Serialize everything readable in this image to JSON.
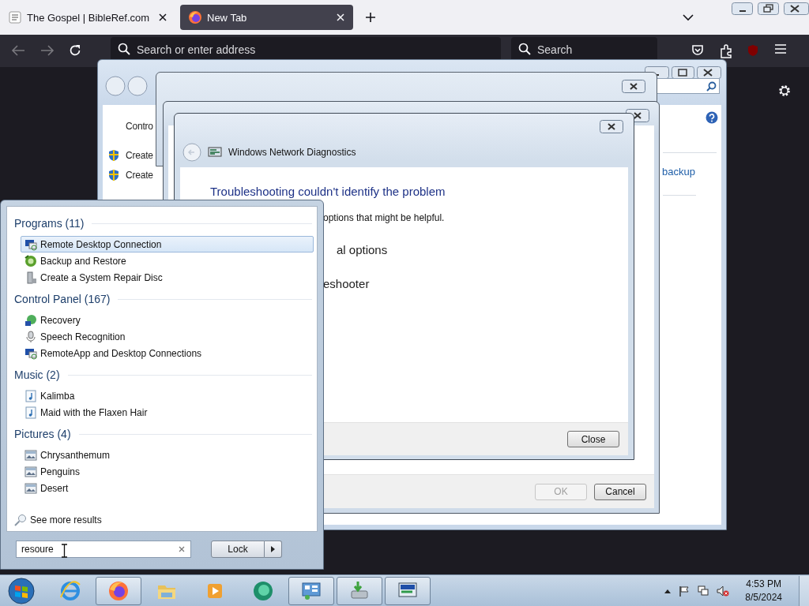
{
  "browser": {
    "tabs": [
      {
        "kind": "book",
        "title": "The Gospel | BibleRef.com",
        "selected": false
      },
      {
        "kind": "firefox",
        "title": "New Tab",
        "selected": true
      }
    ],
    "address_placeholder": "Search or enter address",
    "search_placeholder": "Search"
  },
  "control_panel": {
    "breadcrumb": "Contro",
    "tasks": [
      "Create",
      "Create"
    ],
    "link": "backup"
  },
  "troubleshooter_dialog": {
    "buttons": [
      {
        "label": "OK",
        "disabled": true
      },
      {
        "label": "Cancel",
        "disabled": false
      }
    ]
  },
  "diagnostics_dialog": {
    "title": "Windows Network Diagnostics",
    "heading": "Troubleshooting couldn't identify the problem",
    "text": "options that might be helpful.",
    "options": [
      "al options",
      "eshooter"
    ],
    "button": "Close"
  },
  "start_menu": {
    "groups": [
      {
        "title": "Programs (11)",
        "items": [
          {
            "kind": "remote",
            "label": "Remote Desktop Connection",
            "selected": true
          },
          {
            "kind": "backup",
            "label": "Backup and Restore",
            "selected": false
          },
          {
            "kind": "disc",
            "label": "Create a System Repair Disc",
            "selected": false
          }
        ]
      },
      {
        "title": "Control Panel (167)",
        "items": [
          {
            "kind": "recovery",
            "label": "Recovery",
            "selected": false
          },
          {
            "kind": "speech",
            "label": "Speech Recognition",
            "selected": false
          },
          {
            "kind": "remote",
            "label": "RemoteApp and Desktop Connections",
            "selected": false
          }
        ]
      },
      {
        "title": "Music (2)",
        "items": [
          {
            "kind": "music",
            "label": "Kalimba",
            "selected": false
          },
          {
            "kind": "music",
            "label": "Maid with the Flaxen Hair",
            "selected": false
          }
        ]
      },
      {
        "title": "Pictures (4)",
        "items": [
          {
            "kind": "image",
            "label": "Chrysanthemum",
            "selected": false
          },
          {
            "kind": "image",
            "label": "Penguins",
            "selected": false
          },
          {
            "kind": "image",
            "label": "Desert",
            "selected": false
          }
        ]
      }
    ],
    "see_more": "See more results",
    "search_value": "resoure",
    "power_button": "Lock"
  },
  "taskbar": {
    "apps": [
      {
        "kind": "ie",
        "open": false
      },
      {
        "kind": "firefox",
        "open": true
      },
      {
        "kind": "explorer",
        "open": false
      },
      {
        "kind": "media",
        "open": false
      },
      {
        "kind": "green",
        "open": false
      },
      {
        "kind": "control-panel",
        "open": true
      },
      {
        "kind": "backup",
        "open": true
      },
      {
        "kind": "network",
        "open": true
      }
    ],
    "time": "4:53 PM",
    "date": "8/5/2024"
  }
}
